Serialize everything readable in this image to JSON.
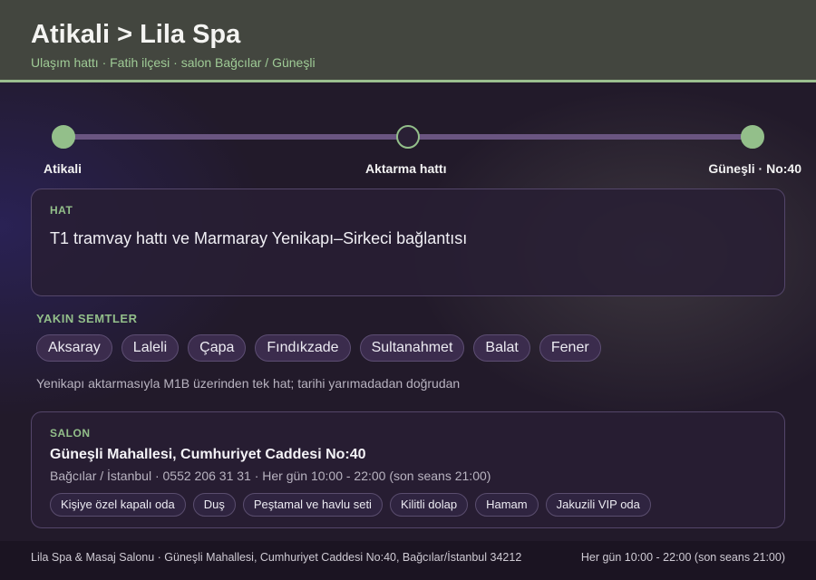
{
  "header": {
    "title": "Atikali > Lila Spa",
    "subtitle": "Ulaşım hattı · Fatih ilçesi · salon Bağcılar / Güneşli"
  },
  "route": {
    "steps": [
      {
        "label": "Atikali",
        "state": "done"
      },
      {
        "label": "Aktarma hattı",
        "state": "transfer"
      },
      {
        "label": "Güneşli · No:40",
        "state": "done"
      }
    ]
  },
  "hat": {
    "kicker": "HAT",
    "text": "T1 tramvay hattı ve Marmaray Yenikapı–Sirkeci bağlantısı"
  },
  "semtler": {
    "title": "YAKIN SEMTLER",
    "items": [
      "Aksaray",
      "Laleli",
      "Çapa",
      "Fındıkzade",
      "Sultanahmet",
      "Balat",
      "Fener"
    ],
    "note": "Yenikapı aktarmasıyla M1B üzerinden tek hat; tarihi yarımadadan doğrudan"
  },
  "salon": {
    "kicker": "SALON",
    "address": "Güneşli Mahallesi, Cumhuriyet Caddesi No:40",
    "meta": "Bağcılar / İstanbul · 0552 206 31 31 · Her gün 10:00 - 22:00 (son seans 21:00)",
    "amenities": [
      "Kişiye özel kapalı oda",
      "Duş",
      "Peştamal ve havlu seti",
      "Kilitli dolap",
      "Hamam",
      "Jakuzili VIP oda"
    ]
  },
  "footer": {
    "left": "Lila Spa & Masaj Salonu · Güneşli Mahallesi, Cumhuriyet Caddesi No:40, Bağcılar/İstanbul 34212",
    "right": "Her gün 10:00 - 22:00 (son seans 21:00)"
  },
  "colors": {
    "accent": "#93bf8a",
    "header_bg": "#43463f",
    "page_bg": "#221a2a",
    "chip_bg": "#3b2c4d"
  }
}
